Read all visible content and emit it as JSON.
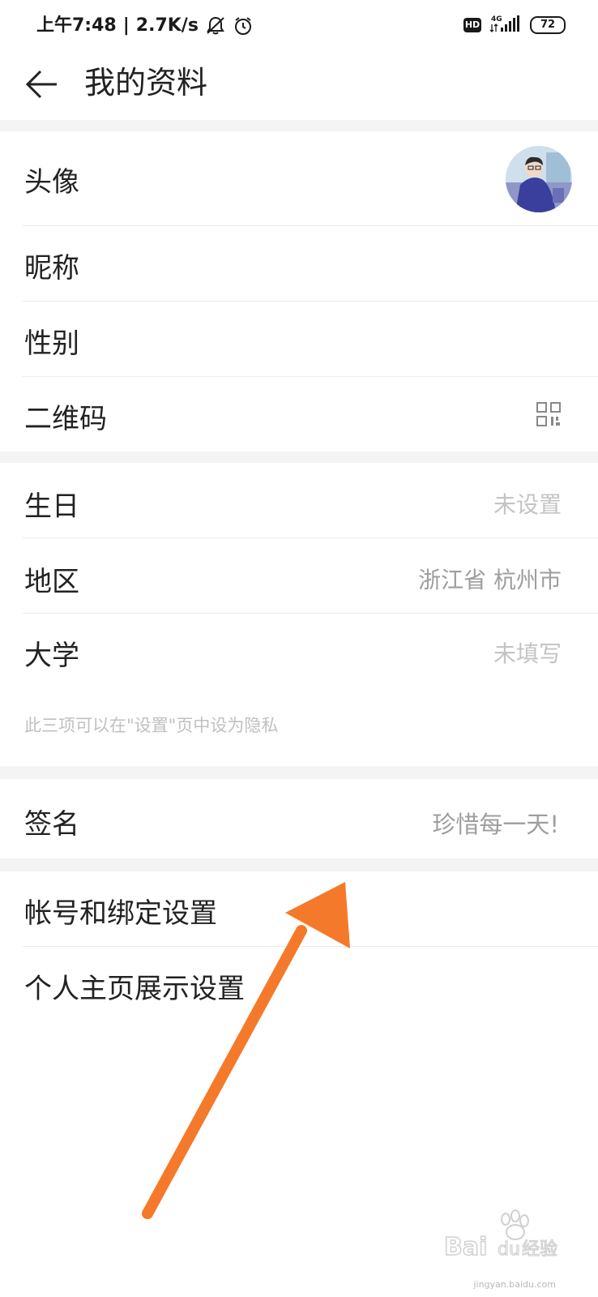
{
  "status_bar": {
    "time": "上午7:48",
    "speed": "2.7K/s",
    "hd": "HD",
    "network": "4G",
    "battery": "72"
  },
  "header": {
    "title": "我的资料"
  },
  "profile": {
    "avatar_label": "头像",
    "nickname_label": "昵称",
    "gender_label": "性别",
    "qrcode_label": "二维码"
  },
  "info": {
    "birthday_label": "生日",
    "birthday_value": "未设置",
    "region_label": "地区",
    "region_value": "浙江省 杭州市",
    "university_label": "大学",
    "university_value": "未填写",
    "privacy_hint": "此三项可以在\"设置\"页中设为隐私"
  },
  "signature": {
    "label": "签名",
    "value": "珍惜每一天!"
  },
  "settings": {
    "account_binding": "帐号和绑定设置",
    "homepage_display": "个人主页展示设置"
  },
  "watermark": {
    "brand": "Bai",
    "brand_cn": "经验",
    "url": "jingyan.baidu.com"
  },
  "colors": {
    "arrow": "#f5792a",
    "divider": "#ececec",
    "section_gap": "#f4f4f4"
  }
}
